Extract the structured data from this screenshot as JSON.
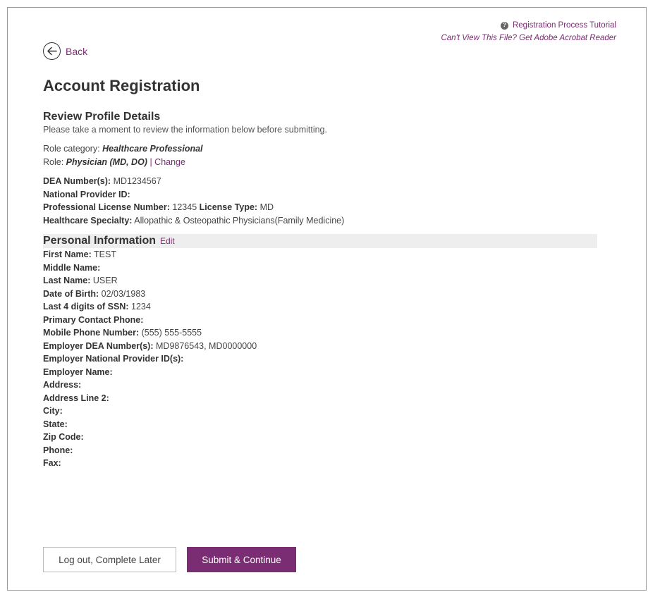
{
  "header": {
    "tutorial_link": "Registration Process Tutorial",
    "help_icon_glyph": "?",
    "adobe_link": "Can't View This File? Get Adobe Acrobat Reader"
  },
  "nav": {
    "back_label": "Back",
    "back_icon": "arrow-left-circle-icon"
  },
  "page": {
    "title": "Account Registration"
  },
  "review": {
    "heading": "Review Profile Details",
    "intro": "Please take a moment to review the information below before submitting.",
    "role_category_label": "Role category:",
    "role_category_value": "Healthcare Professional",
    "role_label": "Role:",
    "role_value": "Physician (MD, DO)",
    "change_link": "| Change"
  },
  "credentials": {
    "dea_label": "DEA Number(s):",
    "dea_value": "MD1234567",
    "npi_label": "National Provider ID:",
    "npi_value": "",
    "license_number_label": "Professional License Number:",
    "license_number_value": "12345",
    "license_type_label": "License Type:",
    "license_type_value": "MD",
    "specialty_label": "Healthcare Specialty:",
    "specialty_value": "Allopathic & Osteopathic Physicians(Family Medicine)"
  },
  "personal": {
    "heading": "Personal Information",
    "edit_link": "Edit",
    "fields": [
      {
        "label": "First Name:",
        "value": "TEST"
      },
      {
        "label": "Middle Name:",
        "value": ""
      },
      {
        "label": "Last Name:",
        "value": "USER"
      },
      {
        "label": "Date of Birth:",
        "value": "02/03/1983"
      },
      {
        "label": "Last 4 digits of SSN:",
        "value": "1234"
      },
      {
        "label": "Primary Contact Phone:",
        "value": ""
      },
      {
        "label": "Mobile Phone Number:",
        "value": "(555) 555-5555"
      },
      {
        "label": "Employer DEA Number(s):",
        "value": "MD9876543, MD0000000"
      },
      {
        "label": "Employer National Provider ID(s):",
        "value": ""
      },
      {
        "label": "Employer Name:",
        "value": ""
      },
      {
        "label": "Address:",
        "value": ""
      },
      {
        "label": "Address Line 2:",
        "value": ""
      },
      {
        "label": "City:",
        "value": ""
      },
      {
        "label": "State:",
        "value": ""
      },
      {
        "label": "Zip Code:",
        "value": ""
      },
      {
        "label": "Phone:",
        "value": ""
      },
      {
        "label": "Fax:",
        "value": ""
      }
    ]
  },
  "actions": {
    "logout_label": "Log out, Complete Later",
    "submit_label": "Submit & Continue"
  },
  "colors": {
    "brand": "#7b2d73",
    "text": "#333333",
    "section_bg": "#eeeeee"
  }
}
